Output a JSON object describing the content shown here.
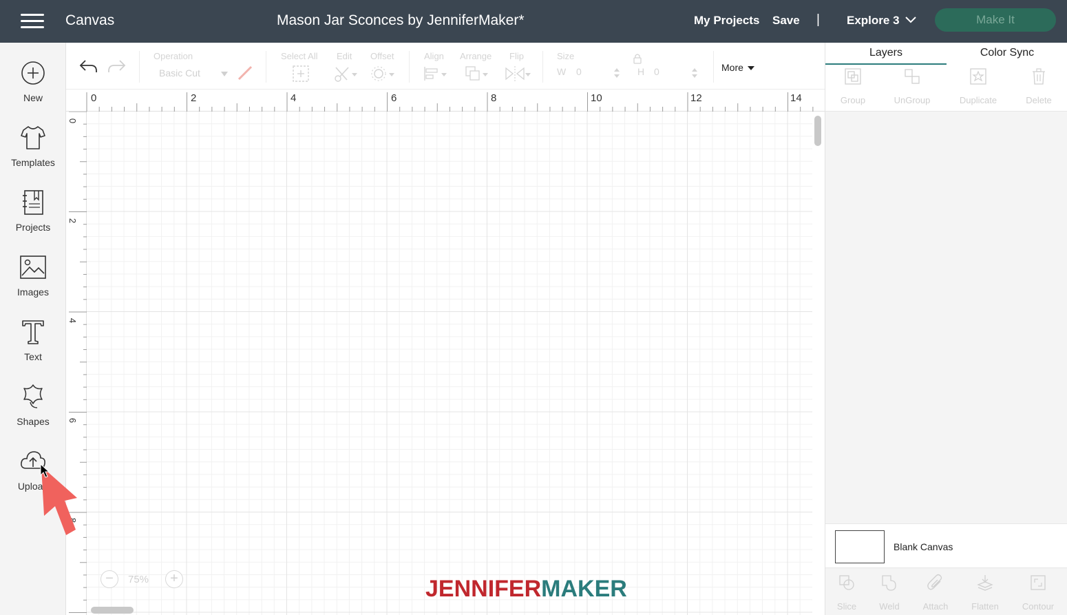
{
  "topbar": {
    "app_title": "Canvas",
    "project_title": "Mason Jar Sconces by JenniferMaker*",
    "my_projects": "My Projects",
    "save": "Save",
    "divider": "|",
    "machine": "Explore 3",
    "make_it": "Make It"
  },
  "sidebar": {
    "items": [
      {
        "label": "New",
        "icon": "plus-circle-icon"
      },
      {
        "label": "Templates",
        "icon": "tshirt-icon"
      },
      {
        "label": "Projects",
        "icon": "notebook-icon"
      },
      {
        "label": "Images",
        "icon": "image-icon"
      },
      {
        "label": "Text",
        "icon": "text-t-icon"
      },
      {
        "label": "Shapes",
        "icon": "shapes-icon"
      },
      {
        "label": "Upload",
        "icon": "cloud-upload-icon"
      }
    ]
  },
  "toolbar": {
    "operation_label": "Operation",
    "operation_value": "Basic Cut",
    "select_all": "Select All",
    "edit": "Edit",
    "offset": "Offset",
    "align": "Align",
    "arrange": "Arrange",
    "flip": "Flip",
    "size": "Size",
    "width_label": "W",
    "width_value": "0",
    "height_label": "H",
    "height_value": "0",
    "more": "More"
  },
  "canvas": {
    "ruler_top": [
      "0",
      "2",
      "4",
      "6",
      "8",
      "10",
      "12",
      "14"
    ],
    "ruler_left": [
      "0",
      "2",
      "4",
      "6",
      "8"
    ],
    "zoom_minus": "−",
    "zoom_plus": "+",
    "zoom_value": "75%",
    "watermark_part1": "JENNIFER",
    "watermark_part2": "MAKER"
  },
  "right_panel": {
    "tabs": [
      "Layers",
      "Color Sync"
    ],
    "active_tab": "Layers",
    "actions": [
      "Group",
      "UnGroup",
      "Duplicate",
      "Delete"
    ],
    "blank_canvas": "Blank Canvas",
    "bottom_actions": [
      "Slice",
      "Weld",
      "Attach",
      "Flatten",
      "Contour"
    ]
  },
  "colors": {
    "topbar": "#3b4651",
    "make_it": "#2c6b5a",
    "accent": "#2b7c7c",
    "pointer": "#f0625d"
  }
}
